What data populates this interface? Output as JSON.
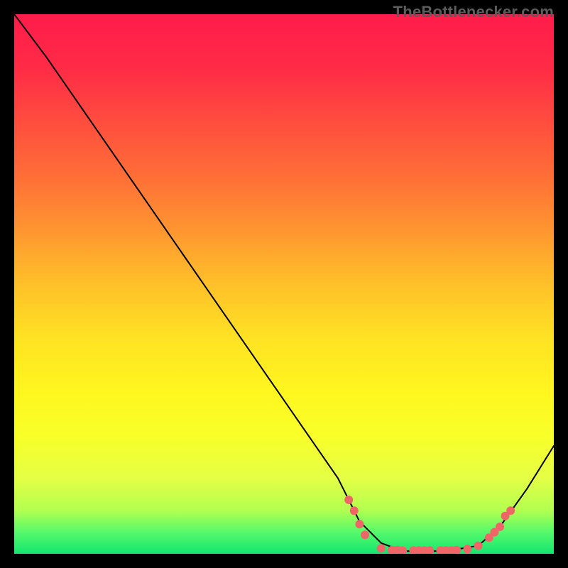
{
  "watermark": "TheBottlenecker.com",
  "chart_data": {
    "type": "line",
    "title": "",
    "xlabel": "",
    "ylabel": "",
    "xlim": [
      0,
      100
    ],
    "ylim": [
      0,
      100
    ],
    "background_gradient": {
      "stops": [
        {
          "offset": 0.0,
          "color": "#ff1c4b"
        },
        {
          "offset": 0.1,
          "color": "#ff2b46"
        },
        {
          "offset": 0.2,
          "color": "#ff4d3e"
        },
        {
          "offset": 0.3,
          "color": "#ff6e37"
        },
        {
          "offset": 0.4,
          "color": "#ff9530"
        },
        {
          "offset": 0.5,
          "color": "#ffc029"
        },
        {
          "offset": 0.6,
          "color": "#ffe223"
        },
        {
          "offset": 0.7,
          "color": "#fff61f"
        },
        {
          "offset": 0.78,
          "color": "#f9ff29"
        },
        {
          "offset": 0.86,
          "color": "#e4ff45"
        },
        {
          "offset": 0.92,
          "color": "#b2ff50"
        },
        {
          "offset": 0.96,
          "color": "#55f96b"
        },
        {
          "offset": 1.0,
          "color": "#14e56f"
        }
      ]
    },
    "curve": [
      {
        "x": 0,
        "y": 100
      },
      {
        "x": 3,
        "y": 96
      },
      {
        "x": 6,
        "y": 92
      },
      {
        "x": 60,
        "y": 14
      },
      {
        "x": 64,
        "y": 6
      },
      {
        "x": 68,
        "y": 2
      },
      {
        "x": 72,
        "y": 0.5
      },
      {
        "x": 80,
        "y": 0.5
      },
      {
        "x": 86,
        "y": 1.5
      },
      {
        "x": 90,
        "y": 5
      },
      {
        "x": 95,
        "y": 12
      },
      {
        "x": 100,
        "y": 20
      }
    ],
    "markers": [
      {
        "x": 62,
        "y": 10
      },
      {
        "x": 63,
        "y": 8
      },
      {
        "x": 64,
        "y": 5.5
      },
      {
        "x": 65,
        "y": 3.5
      },
      {
        "x": 68,
        "y": 1
      },
      {
        "x": 70,
        "y": 0.7
      },
      {
        "x": 71,
        "y": 0.7
      },
      {
        "x": 72,
        "y": 0.6
      },
      {
        "x": 74,
        "y": 0.6
      },
      {
        "x": 75,
        "y": 0.6
      },
      {
        "x": 76,
        "y": 0.6
      },
      {
        "x": 77,
        "y": 0.6
      },
      {
        "x": 79,
        "y": 0.6
      },
      {
        "x": 80,
        "y": 0.6
      },
      {
        "x": 81,
        "y": 0.6
      },
      {
        "x": 82,
        "y": 0.7
      },
      {
        "x": 84,
        "y": 0.9
      },
      {
        "x": 86,
        "y": 1.5
      },
      {
        "x": 88,
        "y": 3
      },
      {
        "x": 89,
        "y": 4
      },
      {
        "x": 90,
        "y": 5
      },
      {
        "x": 91,
        "y": 7
      },
      {
        "x": 92,
        "y": 8
      }
    ],
    "marker_style": {
      "color": "#f06568",
      "radius": 6
    },
    "curve_style": {
      "color": "#000000",
      "width": 2
    }
  }
}
